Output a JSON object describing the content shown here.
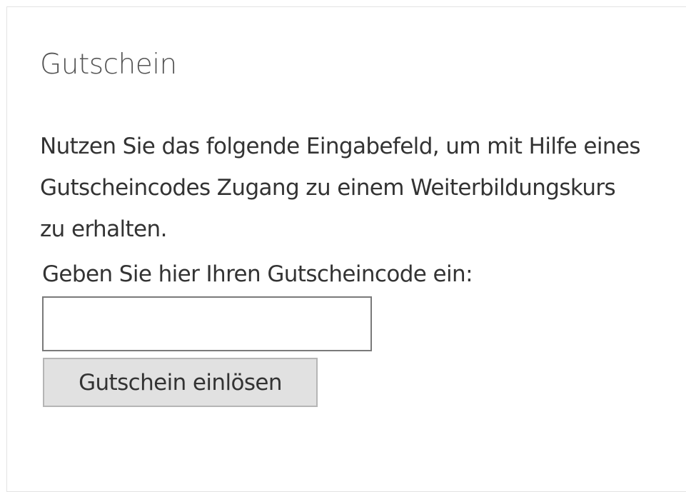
{
  "voucher": {
    "title": "Gutschein",
    "description": "Nutzen Sie das folgende Eingabefeld, um mit Hilfe eines Gutscheincodes Zugang zu einem Weiterbildungskurs zu erhalten.",
    "prompt": "Geben Sie hier Ihren Gutscheincode ein:",
    "input_value": "",
    "button_label": "Gutschein einlösen"
  }
}
